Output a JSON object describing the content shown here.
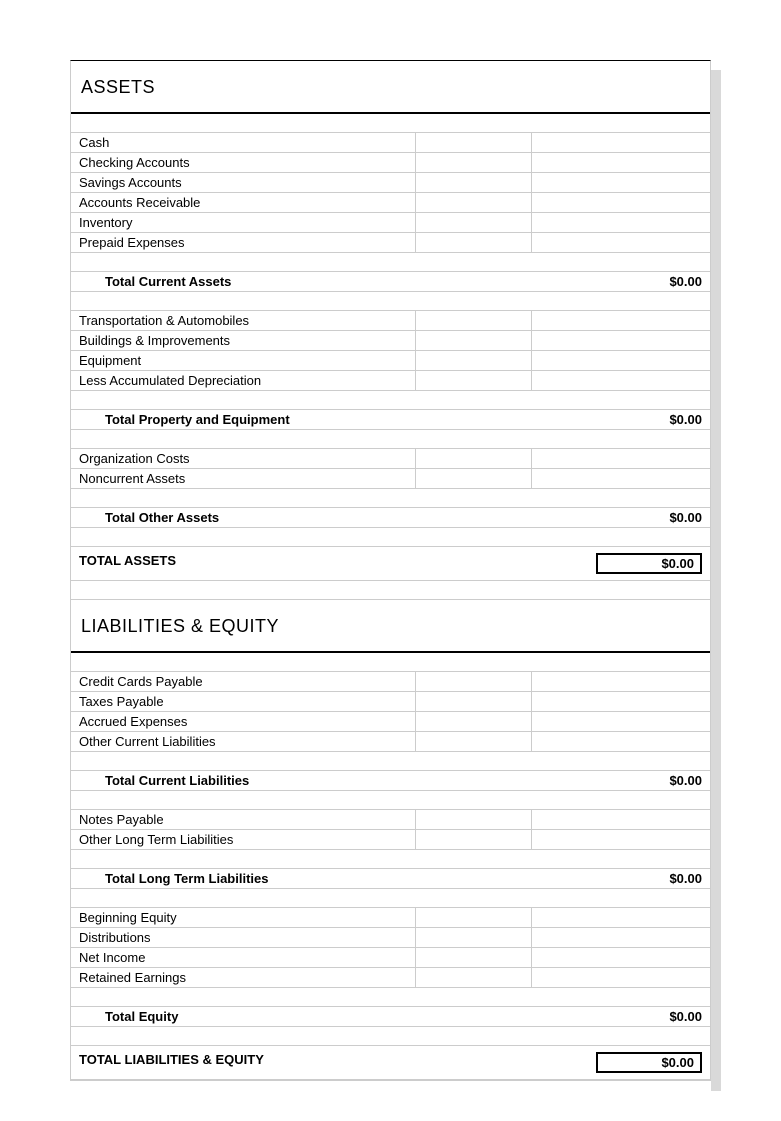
{
  "assets": {
    "title": "ASSETS",
    "current_items": [
      "Cash",
      "Checking Accounts",
      "Savings Accounts",
      "Accounts Receivable",
      "Inventory",
      "Prepaid Expenses"
    ],
    "current_total_label": "Total Current Assets",
    "current_total_value": "$0.00",
    "property_items": [
      "Transportation & Automobiles",
      "Buildings & Improvements",
      "Equipment",
      "Less Accumulated Depreciation"
    ],
    "property_total_label": "Total Property and Equipment",
    "property_total_value": "$0.00",
    "other_items": [
      "Organization Costs",
      "Noncurrent Assets"
    ],
    "other_total_label": "Total Other Assets",
    "other_total_value": "$0.00",
    "grand_total_label": "TOTAL ASSETS",
    "grand_total_value": "$0.00"
  },
  "liabilities": {
    "title": "LIABILITIES & EQUITY",
    "current_items": [
      "Credit Cards Payable",
      "Taxes Payable",
      "Accrued Expenses",
      "Other Current Liabilities"
    ],
    "current_total_label": "Total Current Liabilities",
    "current_total_value": "$0.00",
    "longterm_items": [
      "Notes Payable",
      "Other Long Term Liabilities"
    ],
    "longterm_total_label": "Total Long Term Liabilities",
    "longterm_total_value": "$0.00",
    "equity_items": [
      "Beginning Equity",
      "Distributions",
      "Net Income",
      "Retained Earnings"
    ],
    "equity_total_label": "Total Equity",
    "equity_total_value": "$0.00",
    "grand_total_label": "TOTAL LIABILITIES & EQUITY",
    "grand_total_value": "$0.00"
  }
}
